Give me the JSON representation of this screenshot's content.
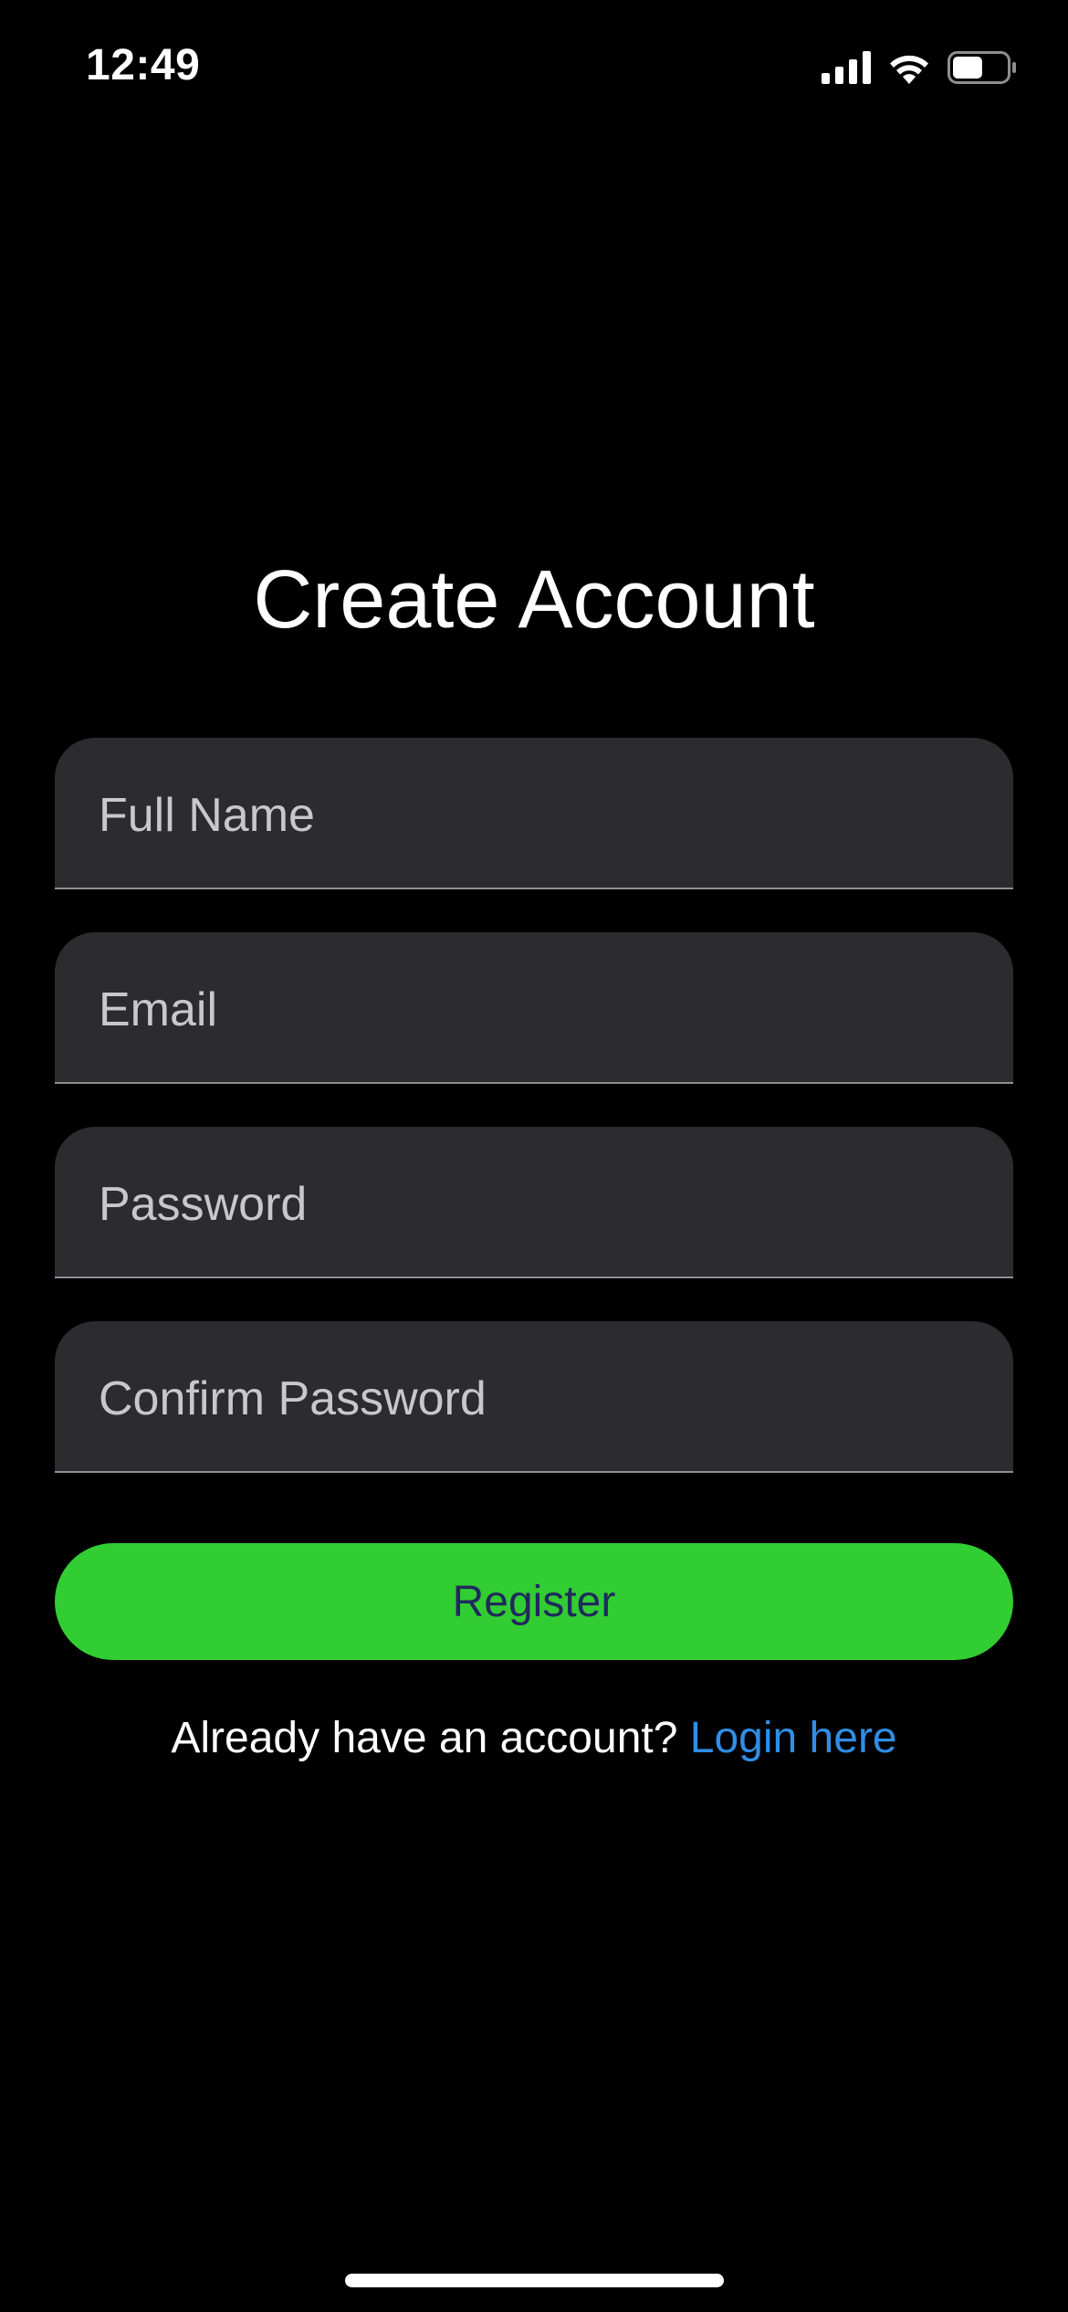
{
  "status_bar": {
    "time": "12:49",
    "icons": [
      "cellular-signal-icon",
      "wifi-icon",
      "battery-icon"
    ],
    "battery_level": 0.55
  },
  "screen": {
    "title": "Create Account"
  },
  "form": {
    "full_name": {
      "placeholder": "Full Name",
      "value": ""
    },
    "email": {
      "placeholder": "Email",
      "value": ""
    },
    "password": {
      "placeholder": "Password",
      "value": ""
    },
    "confirm_password": {
      "placeholder": "Confirm Password",
      "value": ""
    },
    "register_label": "Register"
  },
  "footer": {
    "prompt": "Already have an account?",
    "login_link": "Login here"
  },
  "colors": {
    "background": "#000000",
    "field_background": "#2c2c2e",
    "accent_green": "#32cd32",
    "button_text": "#1f2a5c",
    "link": "#2f8ee5"
  }
}
